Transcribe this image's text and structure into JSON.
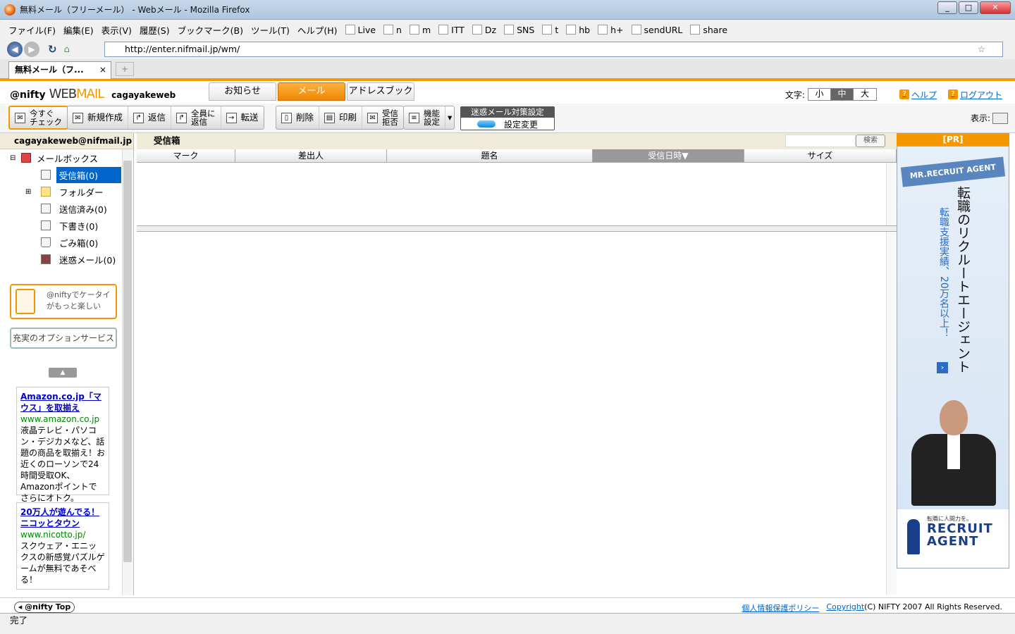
{
  "window": {
    "title": "無料メール（フリーメール） - Webメール - Mozilla Firefox"
  },
  "menu": [
    "ファイル(F)",
    "編集(E)",
    "表示(V)",
    "履歴(S)",
    "ブックマーク(B)",
    "ツール(T)",
    "ヘルプ(H)"
  ],
  "bookmarks": [
    "Live",
    "n",
    "m",
    "ITT",
    "Dz",
    "SNS",
    "t",
    "hb",
    "h+",
    "sendURL",
    "share"
  ],
  "nav": {
    "url": "http://enter.nifmail.jp/wm/"
  },
  "tab": {
    "label": "無料メール（フ...",
    "close": "×",
    "new_tab": "+"
  },
  "app": {
    "brand": "@nifty",
    "product_a": "WEB",
    "product_b": "MAIL",
    "user": "cagayakeweb",
    "tabs": [
      "お知らせ",
      "メール",
      "アドレスブック"
    ],
    "font_size_label": "文字:",
    "font_sizes": [
      "小",
      "中",
      "大"
    ],
    "help": "ヘルプ",
    "logout": "ログアウト"
  },
  "toolbar": {
    "check_now": "今すぐ\nチェック",
    "compose": "新規作成",
    "reply": "返信",
    "reply_all": "全員に\n返信",
    "forward": "転送",
    "delete": "削除",
    "print": "印刷",
    "block": "受信\n拒否",
    "features": "機能\n設定",
    "spam_title": "迷惑メール対策設定",
    "spam_change": "設定変更",
    "display_label": "表示:"
  },
  "sidebar": {
    "account": "cagayakeweb@nifmail.jp",
    "root": "メールボックス",
    "folders": [
      "受信箱(0)",
      "フォルダー",
      "送信済み(0)",
      "下書き(0)",
      "ごみ箱(0)",
      "迷惑メール(0)"
    ],
    "promo": "@niftyでケータイがもっと楽しい",
    "options": "充実のオプションサービス",
    "ads": [
      {
        "title": "Amazon.co.jp「マウス」を取揃え",
        "url": "www.amazon.co.jp",
        "desc": "液晶テレビ・パソコン・デジカメなど、話題の商品を取揃え！お近くのローソンで24時間受取OK、Amazonポイントでさらにオトク。"
      },
      {
        "title": "20万人が遊んでる！ニコッとタウン",
        "url": "www.nicotto.jp/",
        "desc": "スクウェア・エニックスの新感覚パズルゲームが無料であそべる！"
      }
    ]
  },
  "main": {
    "folder_title": "受信箱",
    "search_button": "検索",
    "columns": [
      "マーク",
      "差出人",
      "題名",
      "受信日時▼",
      "サイズ"
    ]
  },
  "ad_right": {
    "pr": "[PR]",
    "badge": "MR.RECRUIT AGENT",
    "headline": "転職のリクルートエージェント",
    "sub": "転職支援実績、20万名以上！",
    "tagline": "転職に人間力を。",
    "logo1": "RECRUIT",
    "logo2": "AGENT"
  },
  "footer": {
    "nifty_top": "@nifty Top",
    "privacy": "個人情報保護ポリシー",
    "copyright_link": "Copyright",
    "copyright_rest": "(C) NIFTY 2007 All Rights Reserved."
  },
  "status": "完了"
}
